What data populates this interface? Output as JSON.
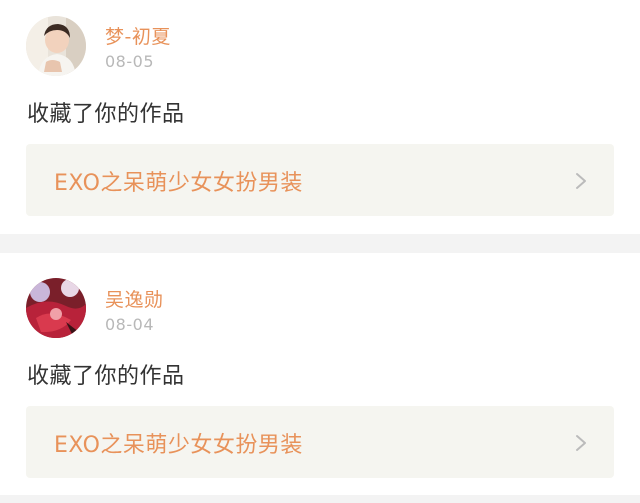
{
  "feed": {
    "items": [
      {
        "user_name": "梦-初夏",
        "date": "08-05",
        "action": "收藏了你的作品",
        "work_title": "EXO之呆萌少女女扮男装",
        "avatar_icon": "avatar-photo-boy"
      },
      {
        "user_name": "吴逸勋",
        "date": "08-04",
        "action": "收藏了你的作品",
        "work_title": "EXO之呆萌少女女扮男装",
        "avatar_icon": "avatar-photo-red-flowers"
      }
    ]
  },
  "colors": {
    "accent": "#e8925a",
    "timestamp": "#b8b8b8",
    "text": "#333333",
    "link_bg": "#f5f5f0",
    "chevron": "#bbbbbb"
  }
}
